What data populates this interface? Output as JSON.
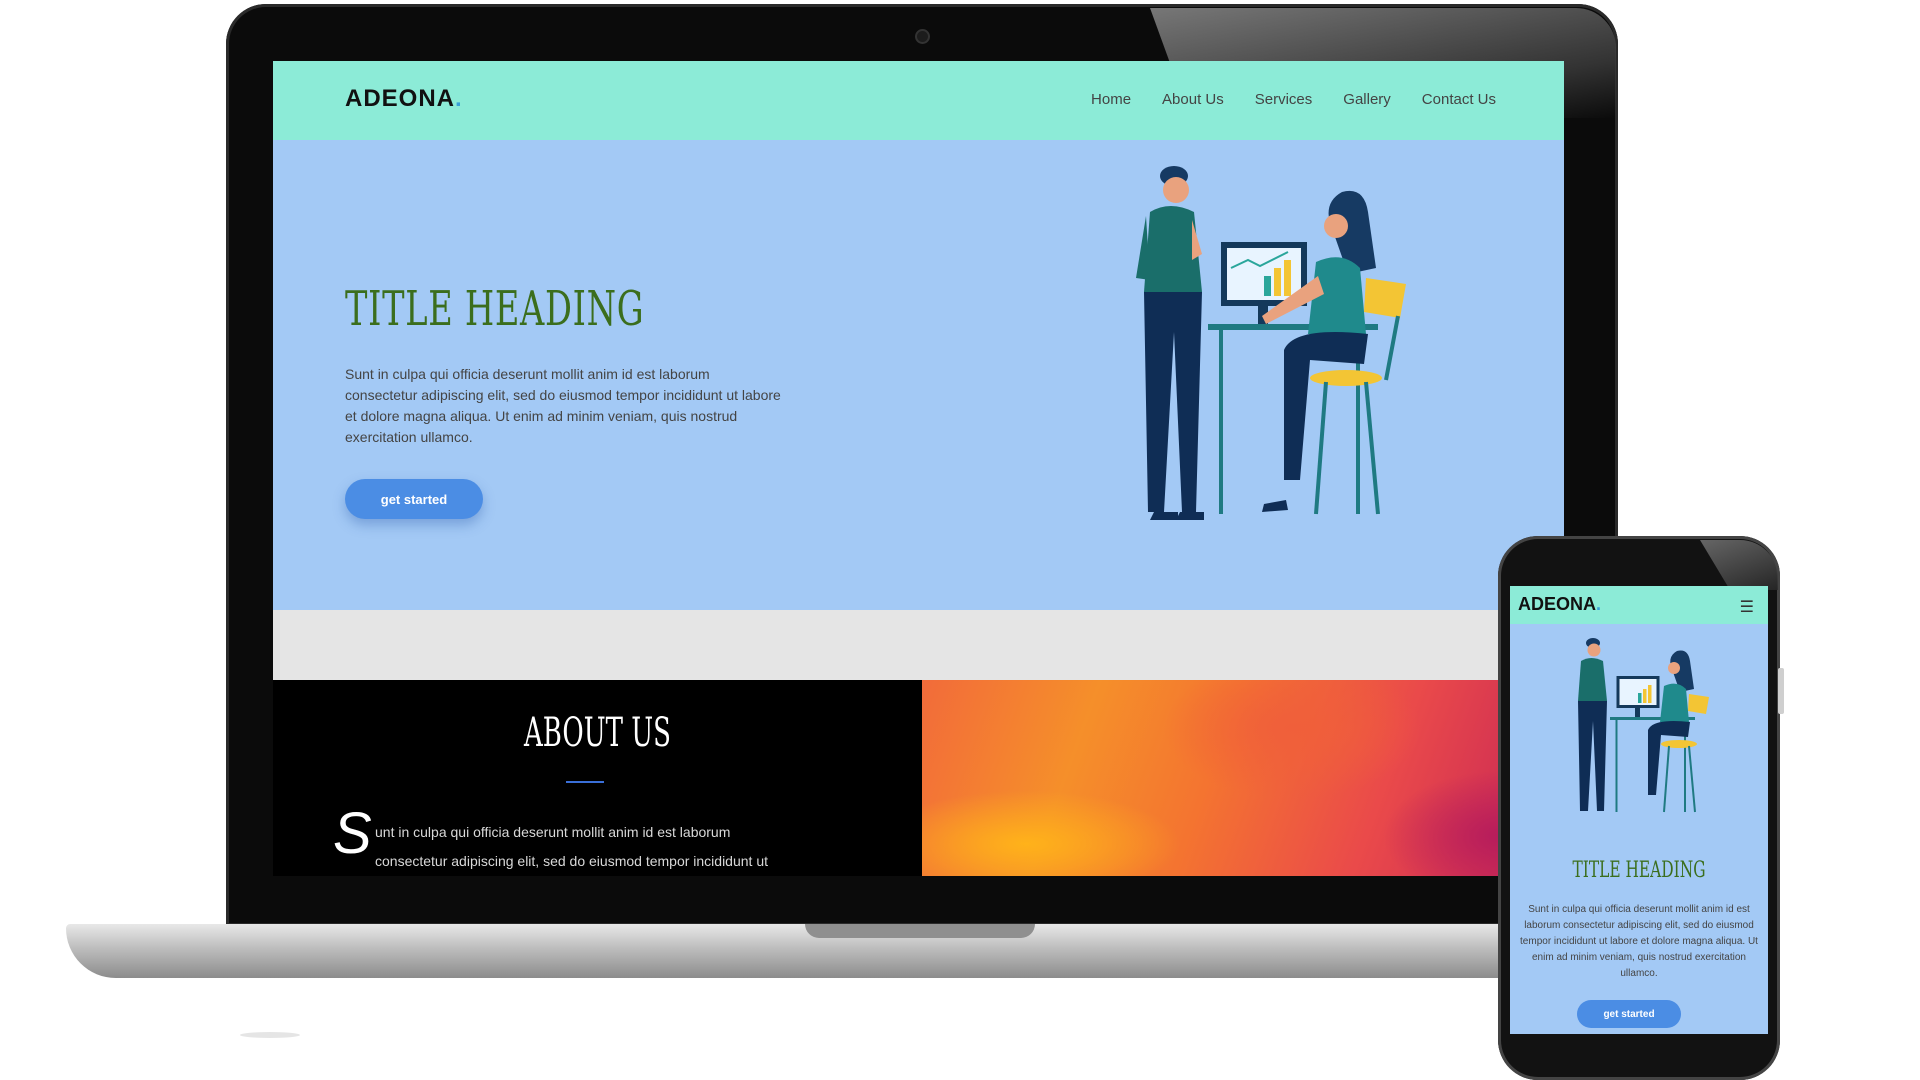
{
  "site": {
    "logo": "ADEONA",
    "logo_dot": ".",
    "nav": [
      "Home",
      "About Us",
      "Services",
      "Gallery",
      "Contact Us"
    ],
    "hero_title": "TITLE HEADING",
    "hero_text": "Sunt in culpa qui officia deserunt mollit anim id est laborum consectetur adipiscing elit, sed do eiusmod tempor incididunt ut labore et dolore magna aliqua. Ut enim ad minim veniam, quis nostrud exercitation ullamco.",
    "cta_label": "get started",
    "about_title": "ABOUT US",
    "about_dropcap": "S",
    "about_text_line1": "unt in culpa qui officia deserunt mollit anim id est laborum",
    "about_text_line2": "consectetur adipiscing elit, sed do eiusmod tempor incididunt ut"
  },
  "mobile": {
    "menu_icon": "☰"
  },
  "icons": [
    "menu-icon"
  ],
  "colors": {
    "header": "#8cebd7",
    "hero": "#a3c9f5",
    "title_green": "#3b6e1d",
    "button": "#4b8de4",
    "about_bg": "#000000",
    "accent_line": "#3a6fd8"
  }
}
